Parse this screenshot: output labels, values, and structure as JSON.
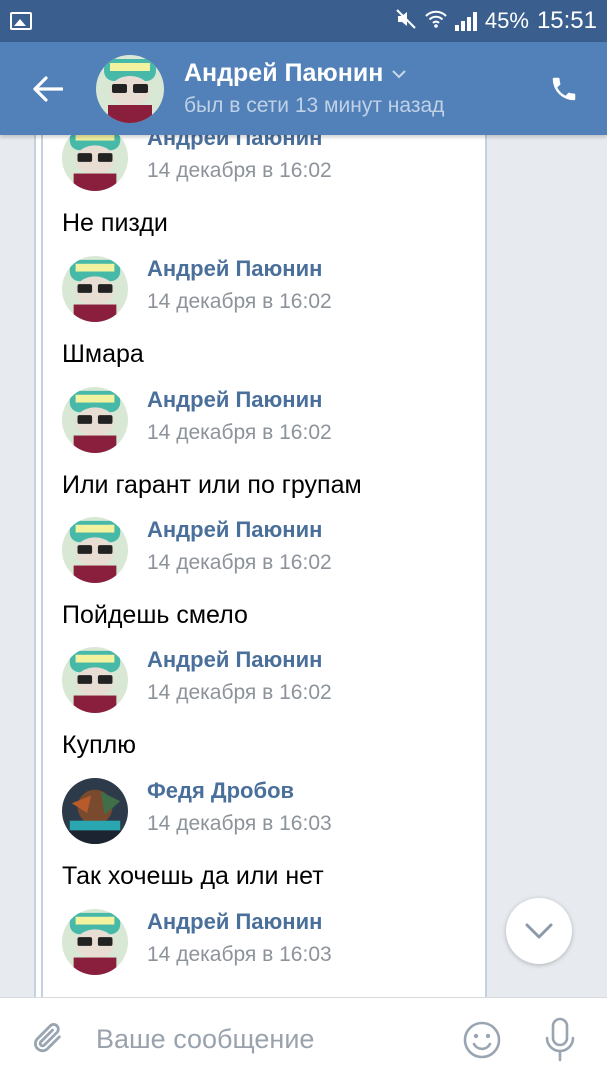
{
  "status_bar": {
    "battery": "45%",
    "time": "15:51"
  },
  "header": {
    "name": "Андрей Паюнин",
    "status": "был в сети 13 минут назад"
  },
  "messages": [
    {
      "author": "Андрей Паюнин",
      "time": "14 декабря в 16:02",
      "text": "Не пизди",
      "avatar": "andrey"
    },
    {
      "author": "Андрей Паюнин",
      "time": "14 декабря в 16:02",
      "text": "Шмара",
      "avatar": "andrey"
    },
    {
      "author": "Андрей Паюнин",
      "time": "14 декабря в 16:02",
      "text": "Или гарант или по групам",
      "avatar": "andrey"
    },
    {
      "author": "Андрей Паюнин",
      "time": "14 декабря в 16:02",
      "text": "Пойдешь смело",
      "avatar": "andrey"
    },
    {
      "author": "Андрей Паюнин",
      "time": "14 декабря в 16:02",
      "text": "Куплю",
      "avatar": "andrey"
    },
    {
      "author": "Федя Дробов",
      "time": "14 декабря в 16:03",
      "text": "Так хочешь да или нет",
      "avatar": "fedya"
    },
    {
      "author": "Андрей Паюнин",
      "time": "14 декабря в 16:03",
      "text": "",
      "avatar": "andrey"
    }
  ],
  "input": {
    "placeholder": "Ваше сообщение"
  },
  "icons": {
    "back": "arrow-left-icon",
    "call": "phone-icon",
    "attach": "paperclip-icon",
    "emoji": "smiley-icon",
    "mic": "microphone-icon",
    "scroll": "chevron-down-icon"
  },
  "colors": {
    "header": "#5181b8",
    "status_bar": "#3a5f8f",
    "author": "#4a6f9b",
    "time": "#8d939a"
  }
}
